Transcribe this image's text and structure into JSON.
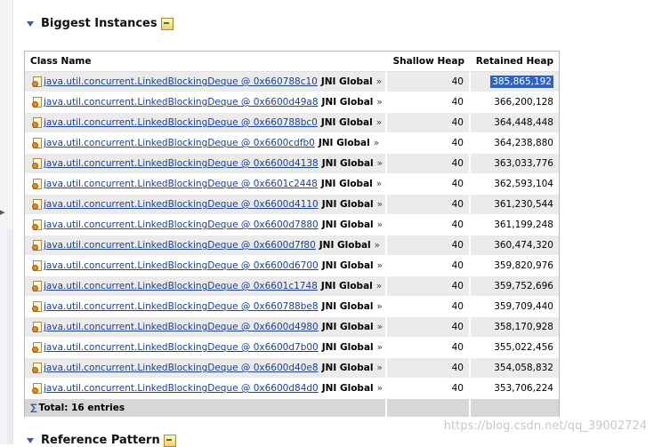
{
  "sections": {
    "biggest_instances_title": "Biggest Instances",
    "reference_pattern_title": "Reference Pattern"
  },
  "table": {
    "columns": [
      "Class Name",
      "Shallow Heap",
      "Retained Heap"
    ],
    "rows": [
      {
        "class": "java.util.concurrent.LinkedBlockingDeque @ 0x660788c10",
        "tag": "JNI Global",
        "shallow": "40",
        "retained": "385,865,192"
      },
      {
        "class": "java.util.concurrent.LinkedBlockingDeque @ 0x6600d49a8",
        "tag": "JNI Global",
        "shallow": "40",
        "retained": "366,200,128"
      },
      {
        "class": "java.util.concurrent.LinkedBlockingDeque @ 0x660788bc0",
        "tag": "JNI Global",
        "shallow": "40",
        "retained": "364,448,448"
      },
      {
        "class": "java.util.concurrent.LinkedBlockingDeque @ 0x6600cdfb0",
        "tag": "JNI Global",
        "shallow": "40",
        "retained": "364,238,880"
      },
      {
        "class": "java.util.concurrent.LinkedBlockingDeque @ 0x6600d4138",
        "tag": "JNI Global",
        "shallow": "40",
        "retained": "363,033,776"
      },
      {
        "class": "java.util.concurrent.LinkedBlockingDeque @ 0x6601c2448",
        "tag": "JNI Global",
        "shallow": "40",
        "retained": "362,593,104"
      },
      {
        "class": "java.util.concurrent.LinkedBlockingDeque @ 0x6600d4110",
        "tag": "JNI Global",
        "shallow": "40",
        "retained": "361,230,544"
      },
      {
        "class": "java.util.concurrent.LinkedBlockingDeque @ 0x6600d7880",
        "tag": "JNI Global",
        "shallow": "40",
        "retained": "361,199,248"
      },
      {
        "class": "java.util.concurrent.LinkedBlockingDeque @ 0x6600d7f80",
        "tag": "JNI Global",
        "shallow": "40",
        "retained": "360,474,320"
      },
      {
        "class": "java.util.concurrent.LinkedBlockingDeque @ 0x6600d6700",
        "tag": "JNI Global",
        "shallow": "40",
        "retained": "359,820,976"
      },
      {
        "class": "java.util.concurrent.LinkedBlockingDeque @ 0x6601c1748",
        "tag": "JNI Global",
        "shallow": "40",
        "retained": "359,752,696"
      },
      {
        "class": "java.util.concurrent.LinkedBlockingDeque @ 0x660788be8",
        "tag": "JNI Global",
        "shallow": "40",
        "retained": "359,709,440"
      },
      {
        "class": "java.util.concurrent.LinkedBlockingDeque @ 0x6600d4980",
        "tag": "JNI Global",
        "shallow": "40",
        "retained": "358,170,928"
      },
      {
        "class": "java.util.concurrent.LinkedBlockingDeque @ 0x6600d7b00",
        "tag": "JNI Global",
        "shallow": "40",
        "retained": "355,022,456"
      },
      {
        "class": "java.util.concurrent.LinkedBlockingDeque @ 0x6600d40e8",
        "tag": "JNI Global",
        "shallow": "40",
        "retained": "354,058,832"
      },
      {
        "class": "java.util.concurrent.LinkedBlockingDeque @ 0x6600d84d0",
        "tag": "JNI Global",
        "shallow": "40",
        "retained": "353,706,224"
      }
    ],
    "selected_row": 0,
    "total_label": "Total: 16 entries",
    "chevron": "»"
  },
  "watermark": "https://blog.csdn.net/qq_39002724",
  "colors": {
    "link": "#1a3fa0",
    "selection": "#2d63c8",
    "alt_row": "#ebebeb"
  },
  "icons": [
    "collapse-triangle-icon",
    "section-action-icon",
    "object-instance-icon",
    "sigma-icon",
    "left-expand-arrow-icon"
  ]
}
